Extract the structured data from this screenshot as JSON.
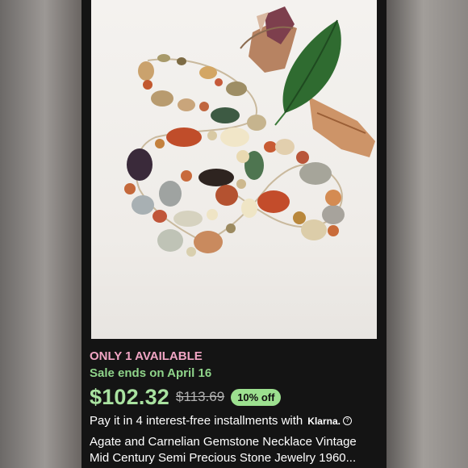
{
  "listing": {
    "availability": "ONLY 1 AVAILABLE",
    "sale_note": "Sale ends on April 16",
    "price": "$102.32",
    "original_price": "$113.69",
    "discount_badge": "10% off",
    "installments": "Pay it in 4 interest-free installments with",
    "klarna": "Klarna.",
    "info_symbol": "?",
    "title_line1": "Agate and Carnelian Gemstone Necklace Vintage",
    "title_line2": "Mid Century Semi Precious Stone Jewelry 1960..."
  },
  "colors": {
    "availability": "#f1a5c4",
    "sale": "#8fd48a",
    "price": "#a9e2a0",
    "discount_bg": "#9ce08f",
    "card_bg": "#141414"
  }
}
